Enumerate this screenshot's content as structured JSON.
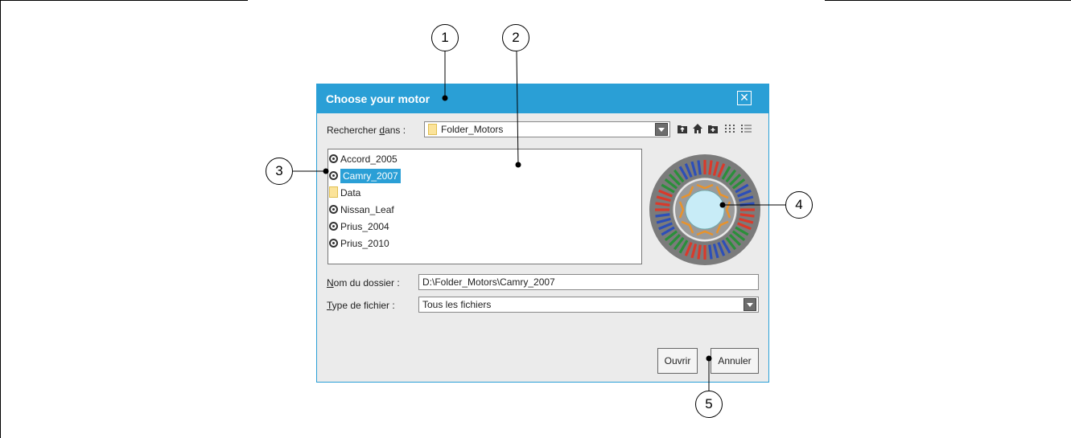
{
  "dialog": {
    "title": "Choose your motor",
    "close_icon": "close-icon"
  },
  "lookin": {
    "label_prefix": "Rechercher ",
    "label_mnemonic": "d",
    "label_suffix": "ans :",
    "value": "Folder_Motors"
  },
  "toolbar": {
    "icons": [
      "up-folder-icon",
      "home-icon",
      "new-folder-icon",
      "list-view-icon",
      "details-view-icon"
    ]
  },
  "files": [
    {
      "name": "Accord_2005",
      "icon": "motor-icon",
      "selected": false
    },
    {
      "name": "Camry_2007",
      "icon": "motor-icon",
      "selected": true
    },
    {
      "name": "Data",
      "icon": "folder-icon",
      "selected": false
    },
    {
      "name": "Nissan_Leaf",
      "icon": "motor-icon",
      "selected": false
    },
    {
      "name": "Prius_2004",
      "icon": "motor-icon",
      "selected": false
    },
    {
      "name": "Prius_2010",
      "icon": "motor-icon",
      "selected": false
    }
  ],
  "folder_name": {
    "label_mnemonic": "N",
    "label_rest": "om du dossier :",
    "value": "D:\\Folder_Motors\\Camry_2007"
  },
  "file_type": {
    "label_mnemonic": "T",
    "label_rest": "ype de fichier :",
    "value": "Tous les fichiers"
  },
  "buttons": {
    "open": "Ouvrir",
    "cancel": "Annuler"
  },
  "callouts": [
    "1",
    "2",
    "3",
    "4",
    "5"
  ],
  "colors": {
    "accent": "#2a9fd6",
    "dialog_bg": "#ebebeb",
    "stator": "#7b7b7b",
    "rotor_bore": "#c8ecf7"
  }
}
